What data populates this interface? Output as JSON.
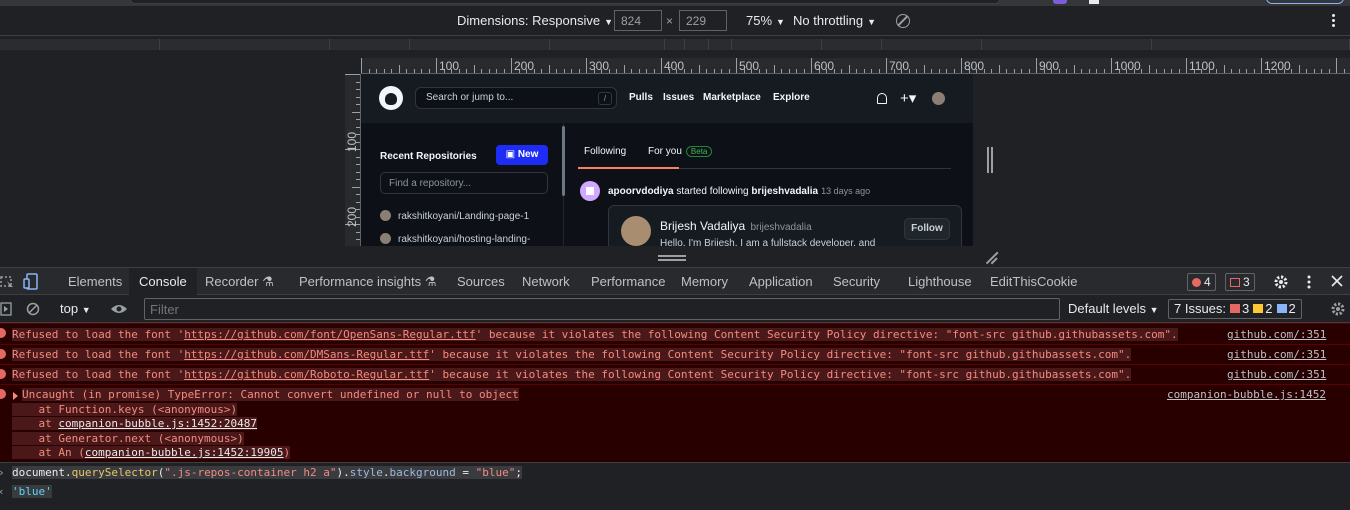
{
  "device_toolbar": {
    "dimensions_label": "Dimensions: Responsive",
    "width_value": "824",
    "height_value": "229",
    "zoom": "75%",
    "throttling": "No throttling"
  },
  "ruler": {
    "h_labels": [
      "100",
      "200",
      "300",
      "400",
      "500",
      "600",
      "700",
      "800",
      "900",
      "1000",
      "1100",
      "1200"
    ],
    "v_labels": [
      "100",
      "200"
    ]
  },
  "github": {
    "search_placeholder": "Search or jump to...",
    "search_key": "/",
    "nav": [
      "Pulls",
      "Issues",
      "Marketplace",
      "Explore"
    ],
    "recent_repos_title": "Recent Repositories",
    "new_button": "New",
    "find_placeholder": "Find a repository...",
    "repos": [
      "rakshitkoyani/Landing-page-1",
      "rakshitkoyani/hosting-landing-"
    ],
    "feed_tabs": [
      "Following",
      "For you"
    ],
    "beta_badge": "Beta",
    "feed_event": {
      "actor": "apoorvdodiya",
      "action": " started following ",
      "target": "brijeshvadalia",
      "time": "13 days ago"
    },
    "card": {
      "name": "Brijesh Vadaliya",
      "username": "brijeshvadalia",
      "bio": "Hello, I'm Brijesh. I am a fullstack developer, and",
      "follow": "Follow"
    }
  },
  "devtools": {
    "tabs": [
      "Elements",
      "Console",
      "Recorder",
      "Performance insights",
      "Sources",
      "Network",
      "Performance",
      "Memory",
      "Application",
      "Security",
      "Lighthouse",
      "EditThisCookie"
    ],
    "active_tab": "Console",
    "error_count": "4",
    "warning_count": "3",
    "console_toolbar": {
      "context": "top",
      "filter_placeholder": "Filter",
      "levels": "Default levels",
      "issues_label": "7 Issues:",
      "issues_red": "3",
      "issues_yellow": "2",
      "issues_blue": "2"
    }
  },
  "console": {
    "csp_errors": [
      {
        "pre": "Refused to load the font '",
        "url": "https://github.com/font/OpenSans-Regular.ttf",
        "post": "' because it violates the following Content Security Policy directive: \"font-src github.githubassets.com\".",
        "source": "github.com/:351"
      },
      {
        "pre": "Refused to load the font '",
        "url": "https://github.com/DMSans-Regular.ttf",
        "post": "' because it violates the following Content Security Policy directive: \"font-src github.githubassets.com\".",
        "source": "github.com/:351"
      },
      {
        "pre": "Refused to load the font '",
        "url": "https://github.com/Roboto-Regular.ttf",
        "post": "' because it violates the following Content Security Policy directive: \"font-src github.githubassets.com\".",
        "source": "github.com/:351"
      }
    ],
    "uncaught": {
      "message": "Uncaught (in promise) TypeError: Cannot convert undefined or null to object",
      "source": "companion-bubble.js:1452",
      "stack1": "    at Function.keys (<anonymous>)",
      "stack2_pre": "    at ",
      "stack2_link": "companion-bubble.js:1452:20487",
      "stack3": "    at Generator.next (<anonymous>)",
      "stack4_pre": "    at An (",
      "stack4_link": "companion-bubble.js:1452:19905",
      "stack4_post": ")"
    },
    "command": {
      "obj": "document",
      "dot1": ".",
      "fn": "querySelector",
      "open": "(",
      "selector": "\".js-repos-container h2 a\"",
      "close": ")",
      "dot2": ".",
      "prop1": "style",
      "dot3": ".",
      "prop2": "background",
      "eq": " = ",
      "value": "\"blue\"",
      "semi": ";"
    },
    "result": "'blue'"
  }
}
